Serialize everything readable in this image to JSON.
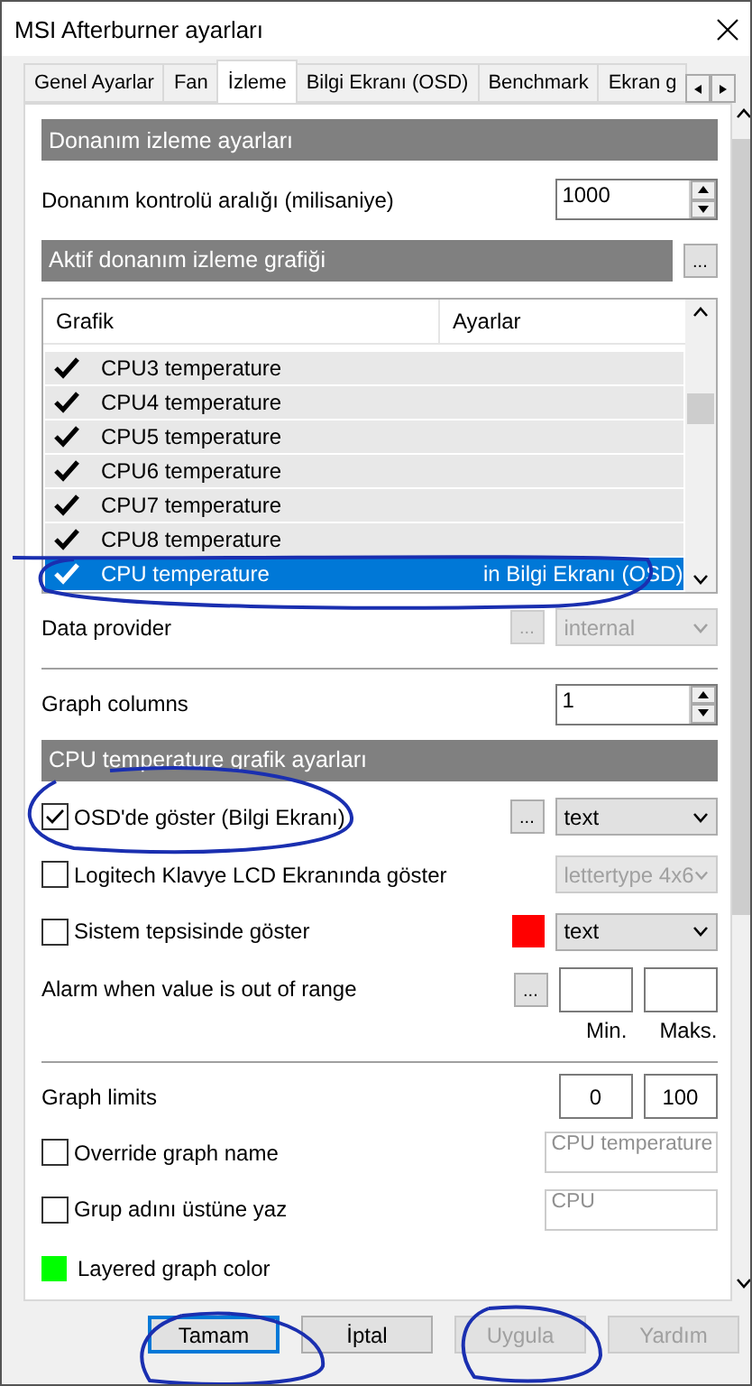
{
  "window": {
    "title": "MSI Afterburner ayarları"
  },
  "tabs": [
    {
      "label": "Genel Ayarlar",
      "selected": false
    },
    {
      "label": "Fan",
      "selected": false
    },
    {
      "label": "İzleme",
      "selected": true
    },
    {
      "label": "Bilgi Ekranı (OSD)",
      "selected": false
    },
    {
      "label": "Benchmark",
      "selected": false
    },
    {
      "label": "Ekran g",
      "selected": false
    }
  ],
  "section_1": {
    "title": "Donanım izleme ayarları"
  },
  "polling": {
    "label": "Donanım kontrolü aralığı (milisaniye)",
    "value": "1000"
  },
  "graphs_header": {
    "title": "Aktif donanım izleme grafiği",
    "button": "..."
  },
  "graph_list": {
    "columns": [
      "Grafik",
      "Ayarlar"
    ],
    "rows": [
      {
        "name": "CPU3 temperature",
        "checked": true,
        "selected": false
      },
      {
        "name": "CPU4 temperature",
        "checked": true,
        "selected": false
      },
      {
        "name": "CPU5 temperature",
        "checked": true,
        "selected": false
      },
      {
        "name": "CPU6 temperature",
        "checked": true,
        "selected": false
      },
      {
        "name": "CPU7 temperature",
        "checked": true,
        "selected": false
      },
      {
        "name": "CPU8 temperature",
        "checked": true,
        "selected": false
      },
      {
        "name": "CPU temperature",
        "settings": "in Bilgi Ekranı (OSD)",
        "checked": true,
        "selected": true
      }
    ]
  },
  "data_provider": {
    "label": "Data provider",
    "button": "...",
    "value": "internal",
    "disabled": true
  },
  "graph_columns": {
    "label": "Graph columns",
    "value": "1"
  },
  "section_2": {
    "title": "CPU temperature grafik ayarları"
  },
  "options": [
    {
      "kind": "button",
      "label": "OSD'de göster (Bilgi Ekranı)",
      "checked": true,
      "button": "...",
      "select": "text",
      "disabled": false
    },
    {
      "kind": "plain",
      "label": "Logitech Klavye LCD Ekranında göster",
      "checked": false,
      "select": "lettertype 4x6",
      "disabled": true
    },
    {
      "kind": "swatch",
      "label": "Sistem tepsisinde göster",
      "checked": false,
      "color": "#ff0000",
      "select": "text",
      "disabled": false
    }
  ],
  "alarm": {
    "label": "Alarm when value is out of range",
    "button": "...",
    "min_label": "Min.",
    "max_label": "Maks."
  },
  "graph_limits": {
    "label": "Graph limits",
    "min": "0",
    "max": "100"
  },
  "name_fields": [
    {
      "label": "Override graph name",
      "checked": false,
      "value": "CPU temperature",
      "disabled": true
    },
    {
      "label": "Grup adını üstüne yaz",
      "checked": false,
      "value": "CPU",
      "disabled": true
    }
  ],
  "layered_color": {
    "label": "Layered graph color",
    "color": "#00ff00"
  },
  "buttons": [
    {
      "label": "Tamam",
      "disabled": false,
      "focused": true
    },
    {
      "label": "İptal",
      "disabled": false,
      "focused": false
    },
    {
      "label": "Uygula",
      "disabled": true,
      "focused": false
    },
    {
      "label": "Yardım",
      "disabled": true,
      "focused": false
    }
  ]
}
